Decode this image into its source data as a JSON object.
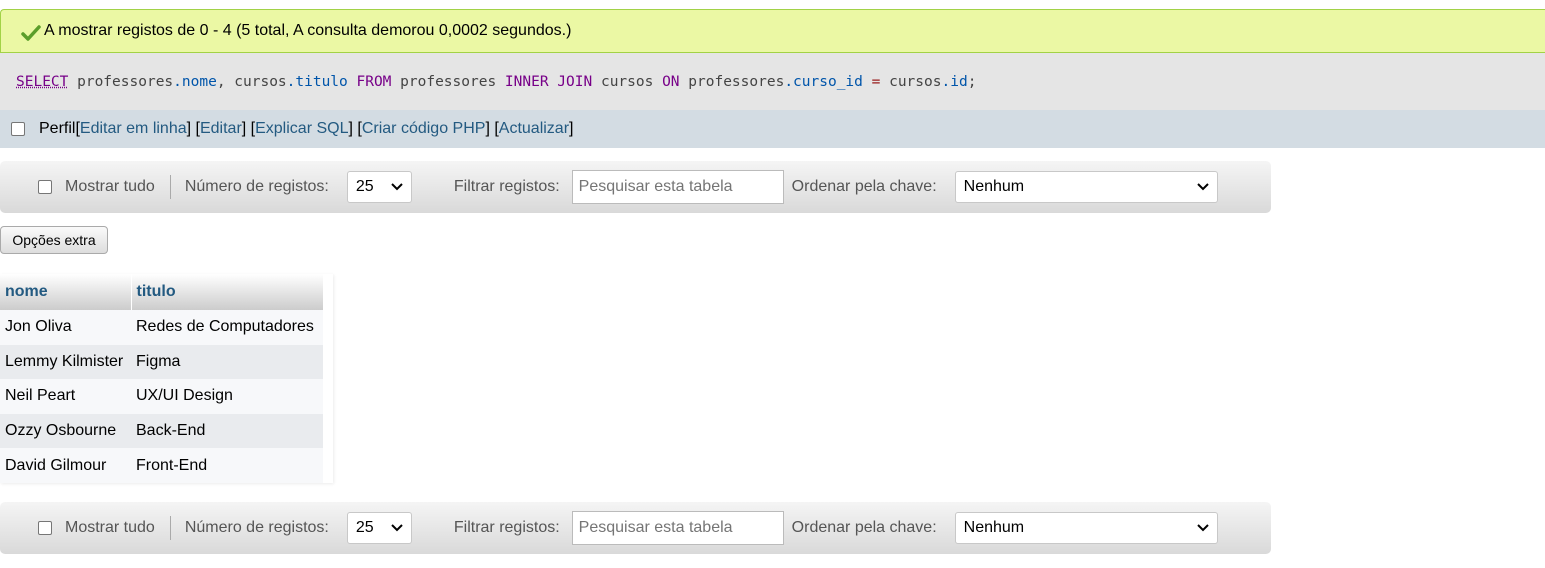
{
  "success": {
    "icon": "check-icon",
    "message": "A mostrar registos de 0 - 4 (5 total, A consulta demorou 0,0002 segundos.)"
  },
  "sql": {
    "t1": "SELECT",
    "t2": " professores",
    "t3": ".nome",
    "t4": ", cursos",
    "t5": ".titulo",
    "t6": " FROM",
    "t7": " professores ",
    "t8": "INNER JOIN",
    "t9": " cursos ",
    "t10": "ON",
    "t11": " professores",
    "t12": ".curso_id",
    "t13": " = ",
    "t14": "cursos",
    "t15": ".id",
    "t16": ";"
  },
  "actions": {
    "profile_label": "Perfil",
    "open": " [ ",
    "mid": " ] [ ",
    "close": " ]",
    "edit_inline": "Editar em linha",
    "edit": "Editar",
    "explain": "Explicar SQL",
    "php": "Criar código PHP",
    "refresh": "Actualizar"
  },
  "navigation": {
    "show_all_label": "Mostrar tudo",
    "rows_label": "Número de registos:",
    "rows_value": "25",
    "filter_label": "Filtrar registos:",
    "filter_placeholder": "Pesquisar esta tabela",
    "sort_label": "Ordenar pela chave:",
    "sort_value": "Nenhum"
  },
  "extra_options_label": "Opções extra",
  "table": {
    "headers": [
      "nome",
      "titulo"
    ],
    "rows": [
      [
        "Jon Oliva",
        "Redes de Computadores"
      ],
      [
        "Lemmy Kilmister",
        "Figma"
      ],
      [
        "Neil Peart",
        "UX/UI Design"
      ],
      [
        "Ozzy Osbourne",
        "Back-End"
      ],
      [
        "David Gilmour",
        "Front-End"
      ]
    ]
  }
}
